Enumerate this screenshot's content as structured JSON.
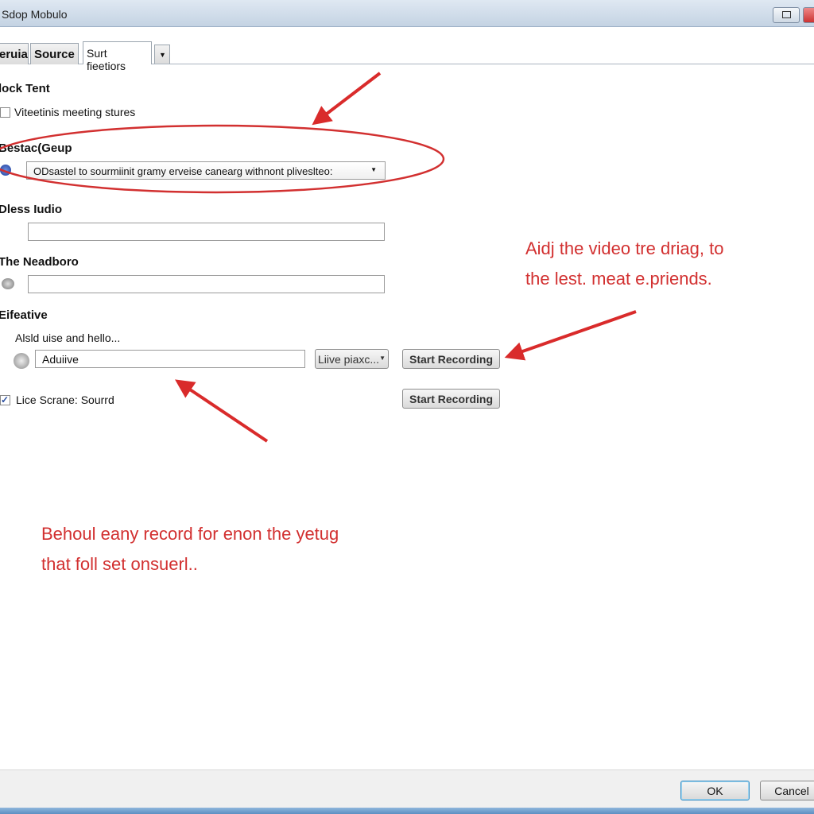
{
  "window": {
    "title": "Sdop Mobulo"
  },
  "tabs": [
    {
      "label": "eruia"
    },
    {
      "label": "Source"
    },
    {
      "label": "Surt fieetiors"
    }
  ],
  "sections": {
    "lock_tent": {
      "heading": "lock Tent",
      "checkbox_label": "Viteetinis meeting stures",
      "checked": false
    },
    "bestac": {
      "heading": "Bestac(Geup",
      "select_value": "ODsastel to sourmiinit gramy erveise canearg withnont pliveslteo:"
    },
    "dless_audio": {
      "heading": "Dless Iudio",
      "input_value": ""
    },
    "neadboro": {
      "heading": "The Neadboro",
      "input_value": ""
    },
    "eifeative": {
      "heading": "Eifeative",
      "sublabel": "Alsld uise and hello...",
      "input_value": "Aduiive",
      "dropdown_value": "Liive piaxc...",
      "record_button": "Start Recording"
    },
    "live_scene": {
      "checkbox_label": "Lice Scrane: Sourrd",
      "checked": true,
      "record_button": "Start Recording"
    }
  },
  "annotations": {
    "note1": [
      "Aidj the video tre driag, to",
      "the lest. meat e.priends."
    ],
    "note2": [
      "Behoul eany record for enon the yetug",
      "that foll set onsuerl.."
    ],
    "color": "#d92b2b"
  },
  "footer": {
    "ok": "OK",
    "cancel": "Cancel"
  }
}
